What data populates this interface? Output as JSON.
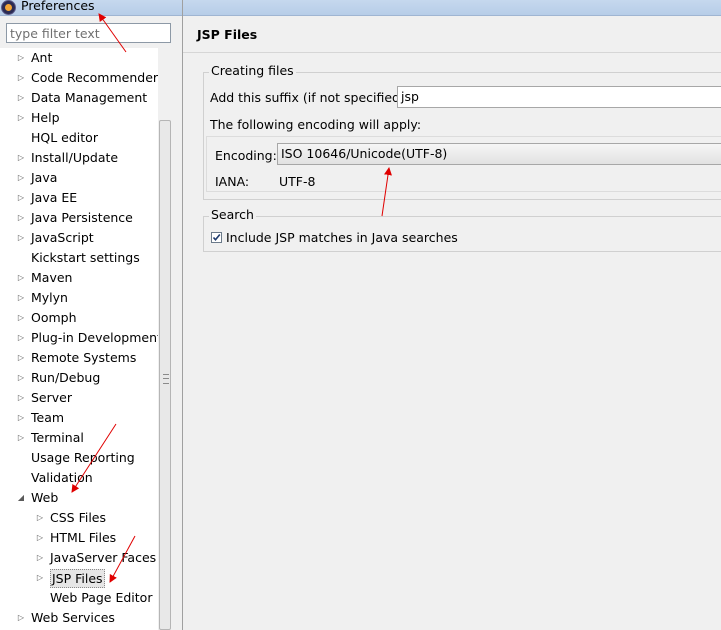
{
  "window": {
    "title": "Preferences",
    "icon": "eclipse-icon"
  },
  "filter": {
    "placeholder": "type filter text"
  },
  "tree": {
    "items": [
      {
        "label": "Ant",
        "expand": "collapsed",
        "level": 0
      },
      {
        "label": "Code Recommenders",
        "expand": "collapsed",
        "level": 0
      },
      {
        "label": "Data Management",
        "expand": "collapsed",
        "level": 0
      },
      {
        "label": "Help",
        "expand": "collapsed",
        "level": 0
      },
      {
        "label": "HQL editor",
        "expand": "none",
        "level": 0
      },
      {
        "label": "Install/Update",
        "expand": "collapsed",
        "level": 0
      },
      {
        "label": "Java",
        "expand": "collapsed",
        "level": 0
      },
      {
        "label": "Java EE",
        "expand": "collapsed",
        "level": 0
      },
      {
        "label": "Java Persistence",
        "expand": "collapsed",
        "level": 0
      },
      {
        "label": "JavaScript",
        "expand": "collapsed",
        "level": 0
      },
      {
        "label": "Kickstart settings",
        "expand": "none",
        "level": 0
      },
      {
        "label": "Maven",
        "expand": "collapsed",
        "level": 0
      },
      {
        "label": "Mylyn",
        "expand": "collapsed",
        "level": 0
      },
      {
        "label": "Oomph",
        "expand": "collapsed",
        "level": 0
      },
      {
        "label": "Plug-in Development",
        "expand": "collapsed",
        "level": 0
      },
      {
        "label": "Remote Systems",
        "expand": "collapsed",
        "level": 0
      },
      {
        "label": "Run/Debug",
        "expand": "collapsed",
        "level": 0
      },
      {
        "label": "Server",
        "expand": "collapsed",
        "level": 0
      },
      {
        "label": "Team",
        "expand": "collapsed",
        "level": 0
      },
      {
        "label": "Terminal",
        "expand": "collapsed",
        "level": 0
      },
      {
        "label": "Usage Reporting",
        "expand": "none",
        "level": 0
      },
      {
        "label": "Validation",
        "expand": "none",
        "level": 0
      },
      {
        "label": "Web",
        "expand": "expanded",
        "level": 0
      },
      {
        "label": "CSS Files",
        "expand": "collapsed",
        "level": 1
      },
      {
        "label": "HTML Files",
        "expand": "collapsed",
        "level": 1
      },
      {
        "label": "JavaServer Faces Tools",
        "expand": "collapsed",
        "level": 1
      },
      {
        "label": "JSP Files",
        "expand": "collapsed",
        "level": 1,
        "selected": true
      },
      {
        "label": "Web Page Editor",
        "expand": "none",
        "level": 1
      },
      {
        "label": "Web Services",
        "expand": "collapsed",
        "level": 0
      }
    ]
  },
  "page": {
    "title": "JSP Files",
    "creating_files": {
      "group_title": "Creating files",
      "suffix_label": "Add this suffix (if not specified):",
      "suffix_value": "jsp",
      "encoding_note": "The following encoding will apply:",
      "encoding_label": "Encoding:",
      "encoding_value": "ISO 10646/Unicode(UTF-8)",
      "iana_label": "IANA:",
      "iana_value": "UTF-8"
    },
    "search": {
      "group_title": "Search",
      "checkbox_label": "Include JSP matches in Java searches",
      "checked": true
    }
  },
  "colors": {
    "annotation_arrow": "#e00000",
    "selection": "#e6e6e6"
  }
}
